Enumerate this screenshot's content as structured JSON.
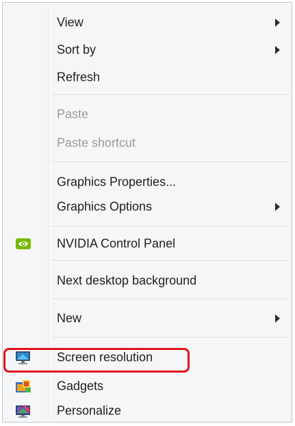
{
  "context_menu": {
    "items": [
      {
        "label": "View",
        "submenu": true,
        "enabled": true
      },
      {
        "label": "Sort by",
        "submenu": true,
        "enabled": true
      },
      {
        "label": "Refresh",
        "submenu": false,
        "enabled": true
      },
      {
        "label": "Paste",
        "submenu": false,
        "enabled": false
      },
      {
        "label": "Paste shortcut",
        "submenu": false,
        "enabled": false
      },
      {
        "label": "Graphics Properties...",
        "submenu": false,
        "enabled": true
      },
      {
        "label": "Graphics Options",
        "submenu": true,
        "enabled": true
      },
      {
        "label": "NVIDIA Control Panel",
        "submenu": false,
        "enabled": true,
        "icon": "nvidia-icon"
      },
      {
        "label": "Next desktop background",
        "submenu": false,
        "enabled": true
      },
      {
        "label": "New",
        "submenu": true,
        "enabled": true
      },
      {
        "label": "Screen resolution",
        "submenu": false,
        "enabled": true,
        "icon": "monitor-icon",
        "highlighted": true
      },
      {
        "label": "Gadgets",
        "submenu": false,
        "enabled": true,
        "icon": "gadgets-icon"
      },
      {
        "label": "Personalize",
        "submenu": false,
        "enabled": true,
        "icon": "personalize-icon"
      }
    ]
  },
  "colors": {
    "menu_background": "#f5f6f7",
    "disabled_text": "#9a9a9a",
    "highlight_outline": "#e0101a",
    "nvidia_green": "#76b900"
  }
}
